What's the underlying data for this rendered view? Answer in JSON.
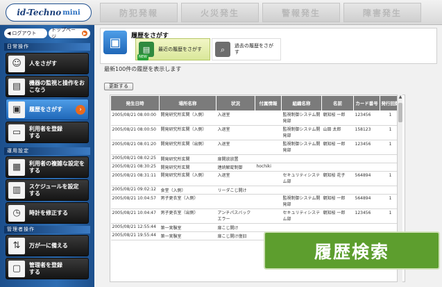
{
  "brand": {
    "logo": "id-Techno",
    "logo_mini": "mini"
  },
  "alerts": [
    "防犯発報",
    "火災発生",
    "警報発生",
    "障害発生"
  ],
  "sidebar": {
    "logout": "ログアウト",
    "top_page": "トップページ",
    "sections": {
      "daily": "日常操作",
      "operation": "運用設定",
      "admin": "管理者操作"
    },
    "items": [
      {
        "label": "人をさがす",
        "icon": "person-icon"
      },
      {
        "label": "機器の監視と操作をおこなう",
        "icon": "device-icon"
      },
      {
        "label": "履歴をさがす",
        "icon": "history-icon"
      },
      {
        "label": "利用者を登録する",
        "icon": "id-card-icon"
      },
      {
        "label": "利用者の複雑な設定をする",
        "icon": "user-settings-icon"
      },
      {
        "label": "スケジュールを設定する",
        "icon": "calendar-icon"
      },
      {
        "label": "時計を修正する",
        "icon": "clock-icon"
      },
      {
        "label": "万が一に備える",
        "icon": "backup-icon"
      },
      {
        "label": "管理者を登録する",
        "icon": "admin-icon"
      }
    ]
  },
  "page": {
    "title": "履歴をさがす",
    "tabs": [
      {
        "label": "最近の履歴をさがす",
        "badge": "NEW",
        "selected": true
      },
      {
        "label": "過去の履歴をさがす",
        "selected": false
      }
    ],
    "info_text": "最新100件の履歴を表示します",
    "refresh_label": "更新する"
  },
  "table": {
    "headers": [
      "発生日時",
      "場所名称",
      "状況",
      "付属情報",
      "組織名称",
      "名前",
      "カード番号",
      "発行回数"
    ],
    "rows": [
      [
        "2005/08/21 08:00:00",
        "開発研究所玄関（入側）",
        "入退室",
        "",
        "監視制御システム開発部",
        "朝知桜 一郎",
        "123456",
        "1"
      ],
      [
        "2005/08/21 08:00:50",
        "開発研究所玄関（入側）",
        "入退室",
        "",
        "監視制御システム開発部",
        "山田 太郎",
        "158123",
        "1"
      ],
      [
        "2005/08/21 08:01:20",
        "開発研究所玄関（出側）",
        "入退室",
        "",
        "監視制御システム開発部",
        "朝知桜 一郎",
        "123456",
        "1"
      ],
      [
        "2005/08/21 08:02:25",
        "開発研究所玄関",
        "扉開放放置",
        "",
        "",
        "",
        "",
        ""
      ],
      [
        "2005/08/21 08:30:25",
        "開発研究所玄関",
        "連続解錠制御",
        "hochiki",
        "",
        "",
        "",
        ""
      ],
      [
        "2005/08/21 08:31:11",
        "開発研究所玄関（入側）",
        "入退室",
        "",
        "セキュリティシステム部",
        "朝知桜 花子",
        "564894",
        "1"
      ],
      [
        "2005/08/21 09:02:12",
        "食堂（入側）",
        "リーダこじ開け",
        "",
        "",
        "",
        "",
        ""
      ],
      [
        "2005/08/21 10:04:57",
        "男子更衣室（入側）",
        "",
        "",
        "監視制御システム開発部",
        "朝知桜 一郎",
        "564894",
        "1"
      ],
      [
        "2005/08/21 10:04:47",
        "男子更衣室（出側）",
        "アンチパスバックエラー",
        "",
        "セキュリティシステム部",
        "朝知桜 一郎",
        "123456",
        "1"
      ],
      [
        "2005/08/21 12:55:44",
        "第一実験室",
        "扉こじ開け",
        "",
        "",
        "",
        "",
        ""
      ],
      [
        "2005/08/21 19:55:44",
        "第一実験室",
        "扉こじ開け復旧",
        "",
        "",
        "",
        "",
        ""
      ]
    ]
  },
  "badge_label": "履歴検索",
  "colors": {
    "sidebar": "#2d6db3",
    "accent": "#e86a1e",
    "badge": "#5d9e2e",
    "header": "#7b7b7b"
  }
}
